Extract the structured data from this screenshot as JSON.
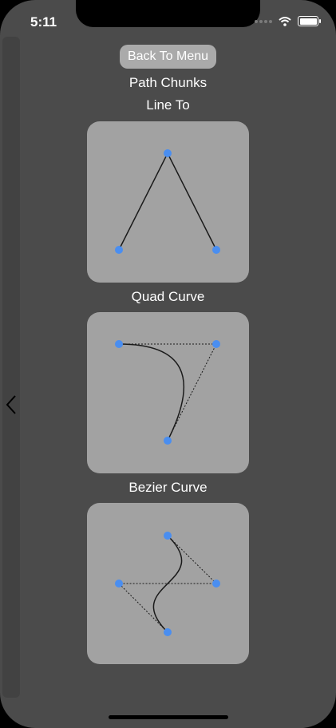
{
  "status_bar": {
    "time": "5:11"
  },
  "back_button": {
    "label": "Back To Menu"
  },
  "page_title": "Path Chunks",
  "sections": [
    {
      "title": "Line To"
    },
    {
      "title": "Quad Curve"
    },
    {
      "title": "Bezier Curve"
    }
  ],
  "colors": {
    "background": "#4b4b4b",
    "card": "#a2a2a2",
    "point": "#4a8ef0",
    "button": "#aaaaaa"
  },
  "icons": [
    "wifi-icon",
    "battery-icon",
    "chevron-left-icon"
  ]
}
